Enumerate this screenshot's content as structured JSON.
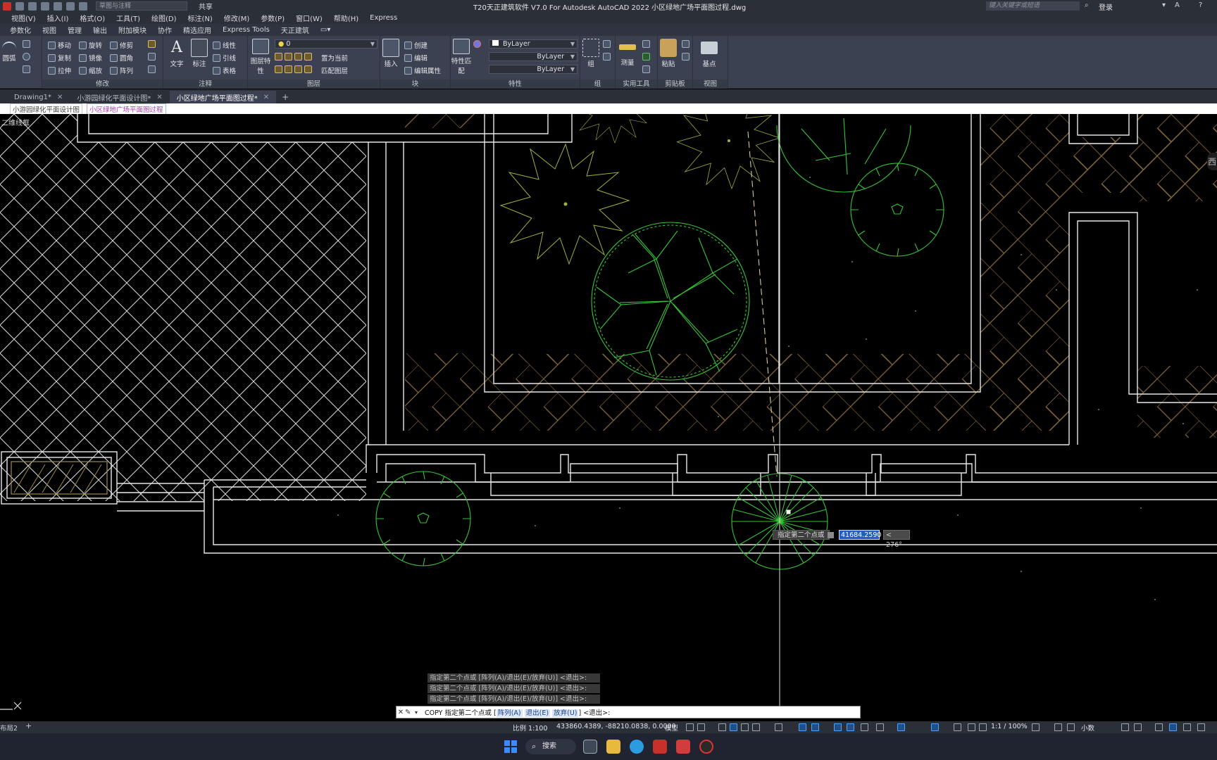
{
  "window": {
    "title": "T20天正建筑软件 V7.0 For Autodesk AutoCAD 2022    小区绿地广场平面图过程.dwg",
    "workspace": "草图与注释",
    "share": "共享",
    "search_placeholder": "键入关键字或短语",
    "login": "登录"
  },
  "menu": [
    "视图(V)",
    "插入(I)",
    "格式(O)",
    "工具(T)",
    "绘图(D)",
    "标注(N)",
    "修改(M)",
    "参数(P)",
    "窗口(W)",
    "帮助(H)",
    "Express"
  ],
  "ribbon_tabs": [
    "参数化",
    "视图",
    "管理",
    "输出",
    "附加模块",
    "协作",
    "精选应用",
    "Express Tools",
    "天正建筑"
  ],
  "ribbon": {
    "draw_big": "圆弧",
    "modify": {
      "title": "修改",
      "move": "移动",
      "rotate": "旋转",
      "trim": "修剪",
      "copy": "复制",
      "mirror": "镜像",
      "fillet": "圆角",
      "stretch": "拉伸",
      "scale": "缩放",
      "array": "阵列"
    },
    "annotation": {
      "title": "注释",
      "text": "文字",
      "dimension": "标注",
      "linear": "线性",
      "leader": "引线",
      "table": "表格"
    },
    "layers": {
      "title": "图层",
      "layer_props": "图层特性",
      "current_layer": "0",
      "set_current": "置为当前",
      "match_layer": "匹配图层"
    },
    "block": {
      "title": "块",
      "insert": "插入",
      "create": "创建",
      "edit": "编辑",
      "edit_attr": "编辑属性"
    },
    "properties": {
      "title": "特性",
      "match": "特性匹配",
      "color": "ByLayer",
      "linetype": "ByLayer",
      "lineweight": "ByLayer"
    },
    "groups": {
      "title": "组",
      "group": "组"
    },
    "utilities": {
      "title": "实用工具",
      "measure": "测量"
    },
    "clipboard": {
      "title": "剪贴板",
      "paste": "粘贴"
    },
    "view": {
      "title": "视图",
      "base": "基点"
    }
  },
  "file_tabs": [
    {
      "label": "Drawing1*",
      "active": false
    },
    {
      "label": "小游园绿化平面设计图*",
      "active": false
    },
    {
      "label": "小区绿地广场平面图过程*",
      "active": true
    }
  ],
  "path_strip": [
    "小游园绿化平面设计图",
    "小区绿地广场平面图过程"
  ],
  "canvas": {
    "viewport": "二维线框",
    "compass": "西"
  },
  "dynamic_input": {
    "prompt": "指定第二个点或",
    "distance": "41684.2590",
    "angle": "< 276°"
  },
  "command_history": [
    "指定第二个点或 [阵列(A)/退出(E)/放弃(U)] <退出>:",
    "指定第二个点或 [阵列(A)/退出(E)/放弃(U)] <退出>:",
    "指定第二个点或 [阵列(A)/退出(E)/放弃(U)] <退出>:"
  ],
  "command_line": {
    "command": "COPY",
    "prompt": "指定第二个点或 [",
    "opt_array": "阵列(A)",
    "opt_exit": "退出(E)",
    "opt_undo": "放弃(U)",
    "tail": "] <退出>:"
  },
  "status": {
    "layout_tab": "布局2",
    "scale": "比例 1:100",
    "coords": "433860.4389, -88210.0838, 0.0000",
    "model": "模型",
    "anno_scale": "1:1 / 100%",
    "units": "小数"
  },
  "taskbar": {
    "search": "搜索"
  },
  "colors": {
    "hatch_white": "#e6e6e6",
    "hatch_gold": "#8a6a3c",
    "tree_green": "#35c535",
    "shrub_yellowgreen": "#9fb23a",
    "accent_blue": "#1d5ec9"
  }
}
